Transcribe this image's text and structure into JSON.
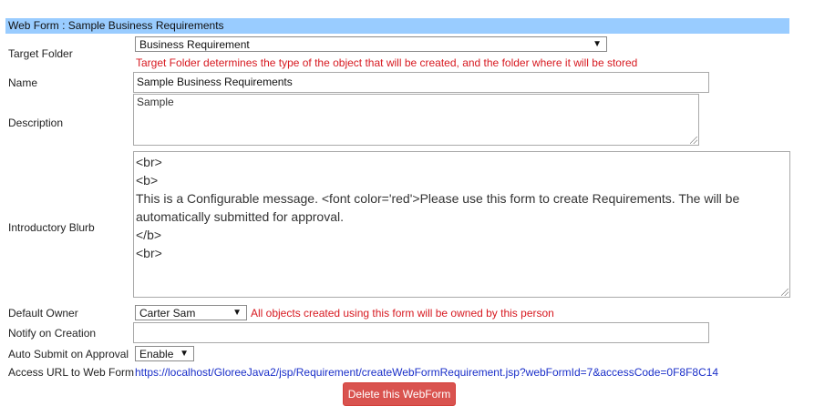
{
  "form": {
    "title": "Web Form : Sample Business Requirements"
  },
  "target_folder": {
    "label": "Target Folder",
    "selected": "Business Requirement",
    "hint": "Target Folder determines the type of the object that will be created, and the folder where it will be stored"
  },
  "name": {
    "label": "Name",
    "value": "Sample Business Requirements"
  },
  "description": {
    "label": "Description",
    "value": "Sample"
  },
  "blurb": {
    "label": "Introductory Blurb",
    "lines": [
      "<br>",
      "<b>",
      "This is a Configurable message. <font color='red'>Please use this form to create Requirements. The will be",
      "automatically submitted for approval.",
      "</b>",
      "<br>"
    ]
  },
  "default_owner": {
    "label": "Default Owner",
    "selected": "Carter Sam",
    "hint": "All objects created using this form will be owned by this person"
  },
  "notify": {
    "label": "Notify on Creation",
    "value": ""
  },
  "auto_submit": {
    "label": "Auto Submit on Approval",
    "selected": "Enable"
  },
  "access_url": {
    "label": "Access URL to Web Form",
    "url": "https://localhost/GloreeJava2/jsp/Requirement/createWebFormRequirement.jsp?webFormId=7&accessCode=0F8F8C14"
  },
  "actions": {
    "delete_label": "Delete this WebForm"
  },
  "icons": {
    "dropdown": "dropdown-arrow-icon",
    "resize": "resize-grip-icon"
  },
  "colors": {
    "title_bar": "#99ccff",
    "hint_red": "#d71920",
    "link_blue": "#1a2fc9",
    "danger_button": "#d9534f"
  }
}
